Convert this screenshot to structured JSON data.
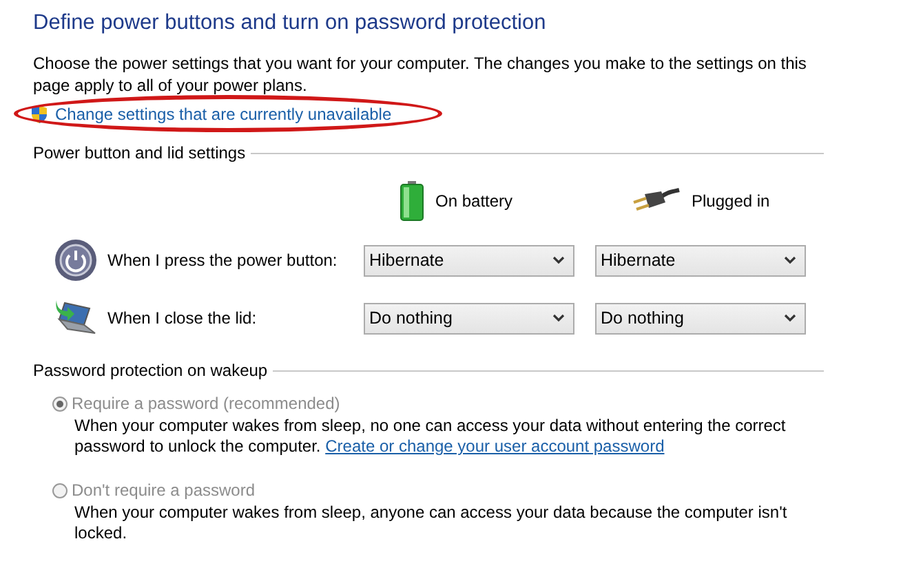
{
  "title": "Define power buttons and turn on password protection",
  "description": "Choose the power settings that you want for your computer. The changes you make to the settings on this page apply to all of your power plans.",
  "admin_link": {
    "label": "Change settings that are currently unavailable"
  },
  "power_section": {
    "heading": "Power button and lid settings",
    "columns": [
      {
        "kind": "battery",
        "label": "On battery"
      },
      {
        "kind": "plug",
        "label": "Plugged in"
      }
    ],
    "rows": [
      {
        "kind": "power",
        "label": "When I press the power button:",
        "values": [
          "Hibernate",
          "Hibernate"
        ]
      },
      {
        "kind": "lid",
        "label": "When I close the lid:",
        "values": [
          "Do nothing",
          "Do nothing"
        ]
      }
    ]
  },
  "password_section": {
    "heading": "Password protection on wakeup",
    "options": [
      {
        "label": "Require a password (recommended)",
        "selected": true,
        "disabled": true,
        "description": "When your computer wakes from sleep, no one can access your data without entering the correct password to unlock the computer.",
        "link": "Create or change your user account password"
      },
      {
        "label": "Don't require a password",
        "selected": false,
        "disabled": true,
        "description": "When your computer wakes from sleep, anyone can access your data because the computer isn't locked."
      }
    ]
  }
}
